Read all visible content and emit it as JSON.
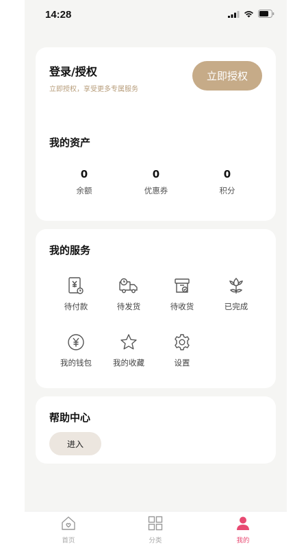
{
  "status_bar": {
    "time": "14:28"
  },
  "login": {
    "title": "登录/授权",
    "subtitle": "立即授权，享受更多专属服务",
    "button": "立即授权"
  },
  "assets": {
    "title": "我的资产",
    "items": [
      {
        "value": "0",
        "label": "余额"
      },
      {
        "value": "0",
        "label": "优惠券"
      },
      {
        "value": "0",
        "label": "积分"
      }
    ]
  },
  "services": {
    "title": "我的服务",
    "items": [
      {
        "label": "待付款",
        "icon": "invoice-icon"
      },
      {
        "label": "待发货",
        "icon": "truck-icon"
      },
      {
        "label": "待收货",
        "icon": "package-icon"
      },
      {
        "label": "已完成",
        "icon": "flower-icon"
      },
      {
        "label": "我的钱包",
        "icon": "yen-coin-icon"
      },
      {
        "label": "我的收藏",
        "icon": "star-icon"
      },
      {
        "label": "设置",
        "icon": "gear-icon"
      }
    ]
  },
  "help": {
    "title": "帮助中心",
    "button": "进入"
  },
  "tabbar": {
    "items": [
      {
        "label": "首页",
        "icon": "home-icon"
      },
      {
        "label": "分类",
        "icon": "grid-icon"
      },
      {
        "label": "我的",
        "icon": "user-icon"
      }
    ],
    "active_color": "#e84a72"
  },
  "colors": {
    "accent": "#c6ab88",
    "subtitle": "#b89e7c",
    "background": "#f5f5f3"
  }
}
